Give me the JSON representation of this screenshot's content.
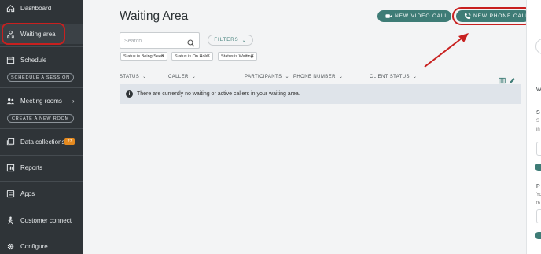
{
  "sidebar": {
    "items": [
      {
        "label": "Dashboard",
        "icon": "home-icon"
      },
      {
        "label": "Waiting area",
        "icon": "waiting-area-icon"
      },
      {
        "label": "Schedule",
        "icon": "calendar-icon"
      },
      {
        "label": "Meeting rooms",
        "icon": "people-icon"
      },
      {
        "label": "Data collections",
        "icon": "data-collections-icon"
      },
      {
        "label": "Reports",
        "icon": "reports-icon"
      },
      {
        "label": "Apps",
        "icon": "apps-icon"
      },
      {
        "label": "Customer connect",
        "icon": "customer-connect-icon"
      },
      {
        "label": "Configure",
        "icon": "gear-icon"
      }
    ],
    "schedule_button": "SCHEDULE A SESSION",
    "room_button": "CREATE A NEW ROOM",
    "data_badge": "27"
  },
  "main": {
    "title": "Waiting Area",
    "video_button": "NEW VIDEO CALL",
    "phone_button": "NEW PHONE CALL",
    "search_placeholder": "Search",
    "filters_label": "FILTERS",
    "chips": [
      "Status is Being Seen",
      "Status is On Hold",
      "Status is Waiting"
    ],
    "columns": [
      "STATUS",
      "CALLER",
      "PARTICIPANTS",
      "PHONE NUMBER",
      "CLIENT STATUS"
    ],
    "notice": "There are currently no waiting or active callers in your waiting area."
  },
  "right_panel": {
    "letters": [
      "W",
      "S",
      "S",
      "in",
      "P",
      "Yo",
      "th"
    ]
  },
  "colors": {
    "sidebar_bg": "#2f3438",
    "accent": "#3e7c76",
    "highlight": "#c8201f",
    "badge": "#e58a1f"
  }
}
